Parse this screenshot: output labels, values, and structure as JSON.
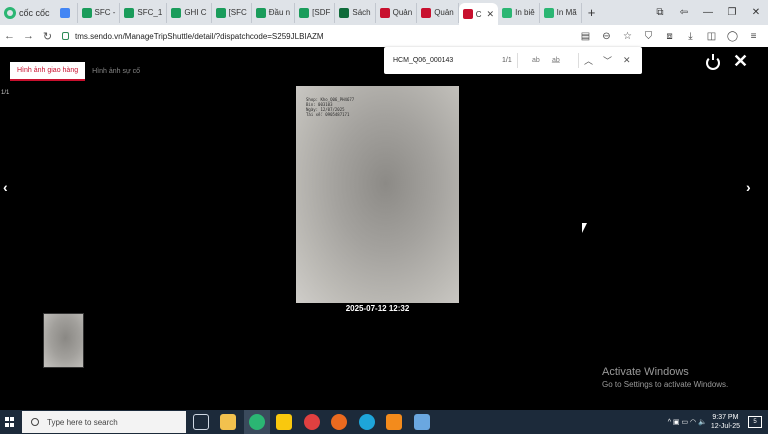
{
  "browser": {
    "brand": "cốc cốc",
    "tabs": [
      {
        "label": "",
        "color": "#4285f4"
      },
      {
        "label": "SFC -",
        "color": "#1a9c5b"
      },
      {
        "label": "SFC_1",
        "color": "#1a9c5b"
      },
      {
        "label": "GHI C",
        "color": "#1a9c5b"
      },
      {
        "label": "[SFC",
        "color": "#1a9c5b"
      },
      {
        "label": "Đầu n",
        "color": "#1a9c5b"
      },
      {
        "label": "[SDF",
        "color": "#1a9c5b"
      },
      {
        "label": "Sách",
        "color": "#0f6b3a"
      },
      {
        "label": "Quản",
        "color": "#c8102e"
      },
      {
        "label": "Quản",
        "color": "#c8102e"
      },
      {
        "label": "C",
        "color": "#c8102e",
        "active": true
      },
      {
        "label": "In biê",
        "color": "#2bb673"
      },
      {
        "label": "In Mã",
        "color": "#2bb673"
      }
    ],
    "new_tab": "+",
    "window_controls": {
      "minimize": "—",
      "maximize": "❐",
      "close": "✕"
    },
    "url": "tms.sendo.vn/ManageTripShuttle/detail/?dispatchcode=S259JLBIAZM"
  },
  "viewer": {
    "tabs": [
      "Hình ảnh giao hàng",
      "Hình ảnh sự cố"
    ],
    "find": {
      "query": "HCM_Q06_000143",
      "count": "1/1",
      "opt_case": "ab",
      "opt_word": "a̲b̲",
      "prev": "︿",
      "next": "﹀",
      "close": "✕"
    },
    "counter": "1/1",
    "photo_stamp": [
      "Shop: Kho_Q06_PH4677",
      "Bin: 003103",
      "Ngày: 12/07/2025",
      "Tài xế: 0905487171"
    ],
    "caption": "2025-07-12 12:32",
    "prev_arrow": "‹",
    "next_arrow": "›"
  },
  "watermark": {
    "title": "Activate Windows",
    "subtitle": "Go to Settings to activate Windows."
  },
  "taskbar": {
    "search_placeholder": "Type here to search",
    "time": "9:37 PM",
    "date": "12-Jul-25",
    "notifications": "5",
    "tray_icons": "^ ▣ ▭ ◠ 🔈"
  }
}
